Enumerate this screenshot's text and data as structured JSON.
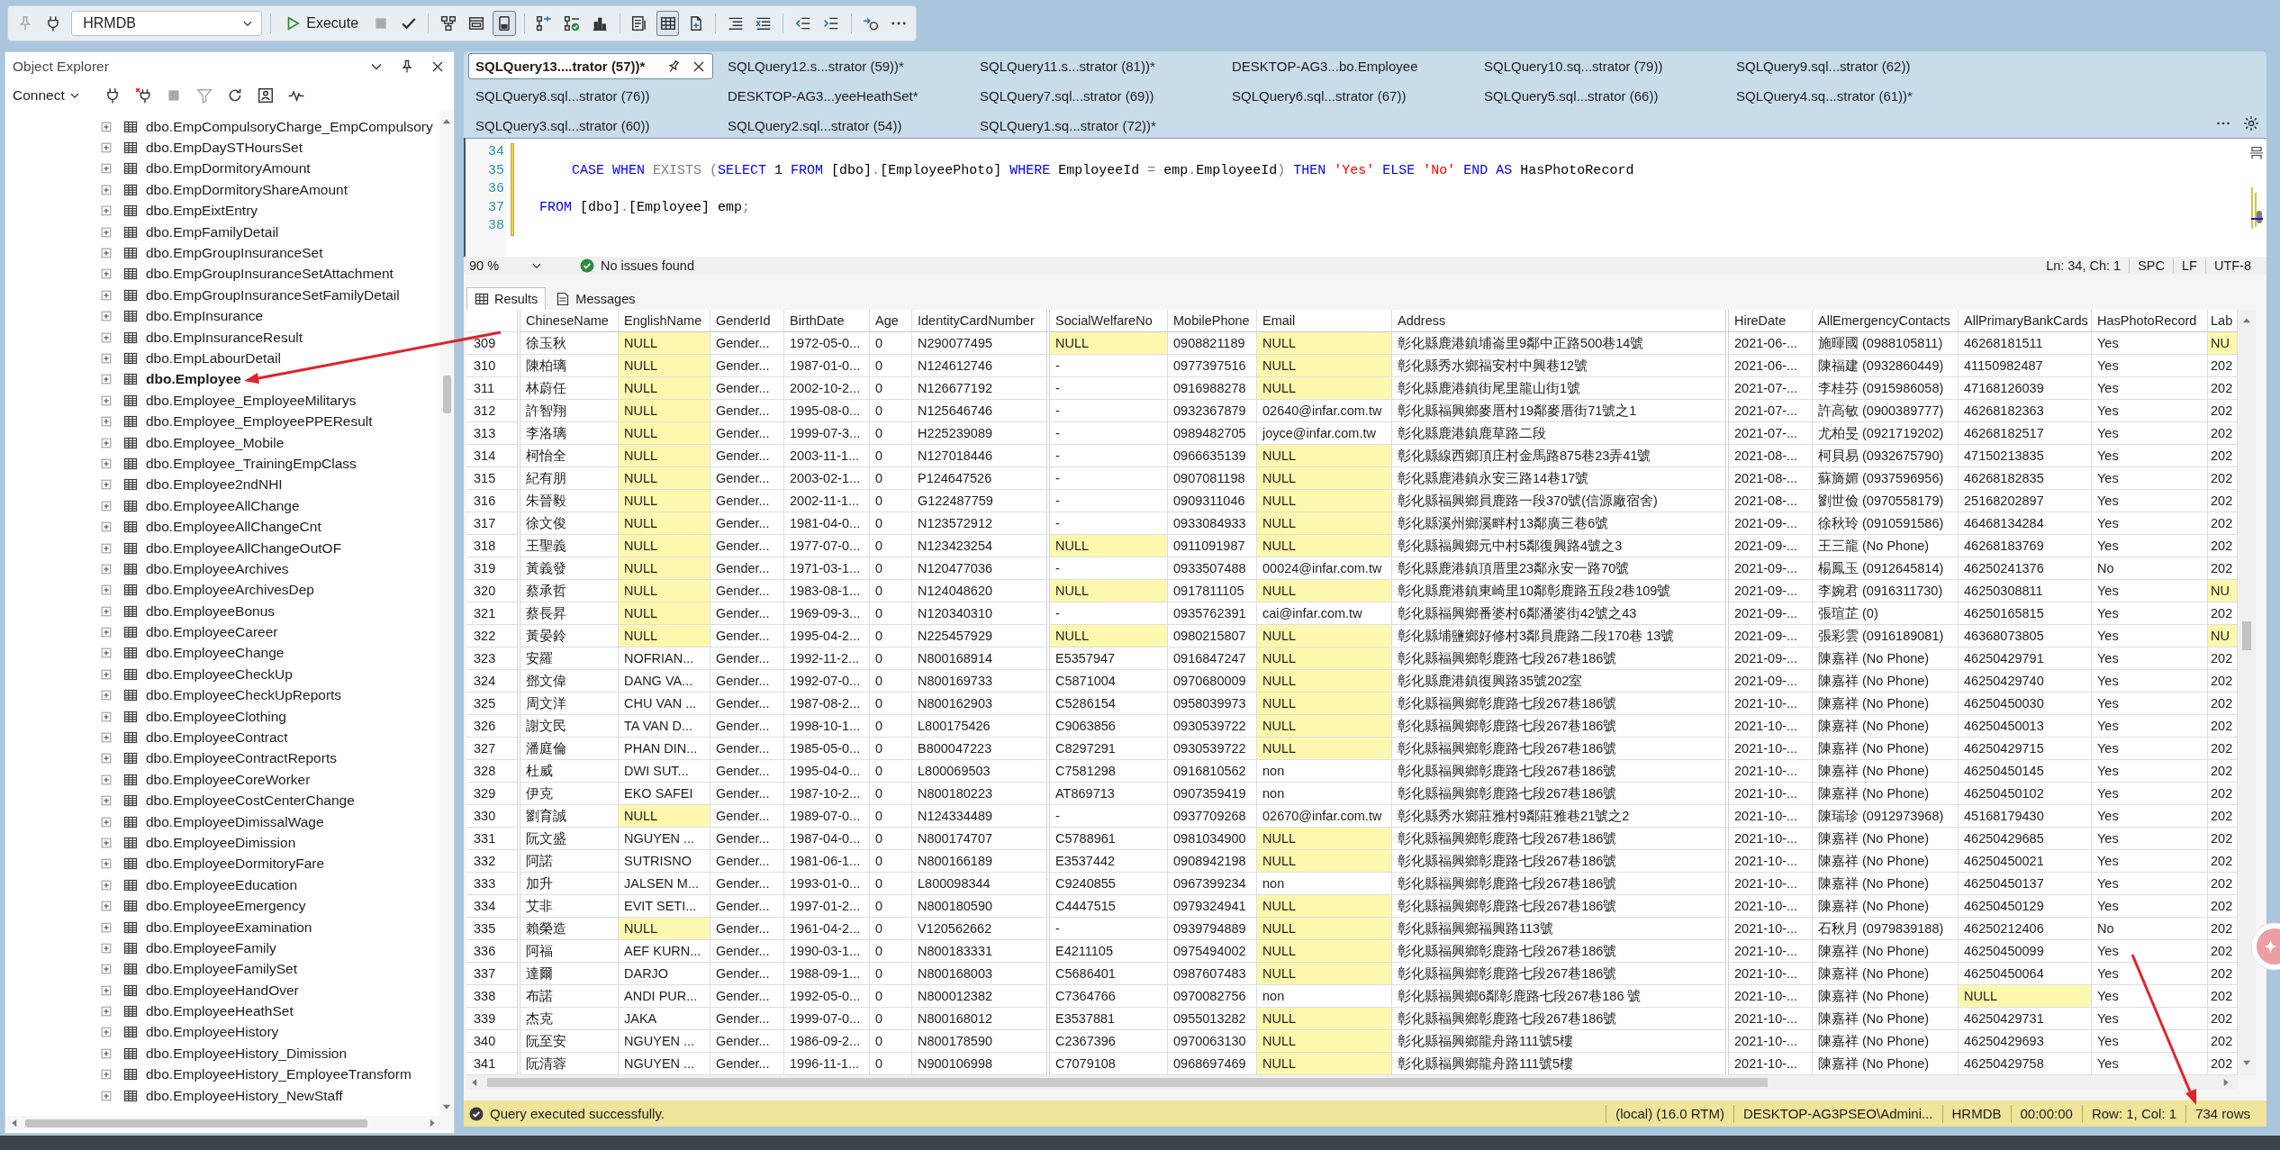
{
  "toolbar": {
    "leading_buttons": [
      {
        "disabled": true
      },
      {
        "disabled": false
      }
    ],
    "database": "HRMDB",
    "execute": "Execute",
    "buttons": [
      {
        "disabled": true,
        "on": false
      },
      {
        "disabled": false,
        "on": false
      },
      {
        "disabled": false,
        "on": false
      },
      {
        "disabled": false,
        "on": false
      },
      {
        "disabled": false,
        "on": true
      },
      {
        "disabled": false,
        "on": false
      },
      {
        "disabled": false,
        "on": false
      },
      {
        "disabled": false,
        "on": false
      },
      {
        "disabled": false,
        "on": false
      },
      {
        "disabled": false,
        "on": true
      },
      {
        "disabled": false,
        "on": false
      },
      {
        "disabled": false,
        "on": false
      },
      {
        "disabled": false,
        "on": false
      },
      {
        "disabled": false,
        "on": false
      },
      {
        "disabled": false,
        "on": false
      },
      {
        "disabled": false,
        "on": false
      },
      {
        "disabled": false,
        "on": false
      }
    ]
  },
  "object_explorer": {
    "title": "Object Explorer",
    "connect": "Connect",
    "toolbar_buttons": [
      {
        "disabled": false
      },
      {
        "disabled": false
      },
      {
        "disabled": true
      },
      {
        "disabled": true
      },
      {
        "disabled": false
      },
      {
        "disabled": false
      },
      {
        "disabled": false
      }
    ],
    "items": [
      {
        "label": "dbo.EmpCompulsoryCharge_EmpCompulsory",
        "expanded": false,
        "selected": false
      },
      {
        "label": "dbo.EmpDaySTHoursSet",
        "expanded": false,
        "selected": false
      },
      {
        "label": "dbo.EmpDormitoryAmount",
        "expanded": false,
        "selected": false
      },
      {
        "label": "dbo.EmpDormitoryShareAmount",
        "expanded": false,
        "selected": false
      },
      {
        "label": "dbo.EmpEixtEntry",
        "expanded": false,
        "selected": false
      },
      {
        "label": "dbo.EmpFamilyDetail",
        "expanded": false,
        "selected": false
      },
      {
        "label": "dbo.EmpGroupInsuranceSet",
        "expanded": false,
        "selected": false
      },
      {
        "label": "dbo.EmpGroupInsuranceSetAttachment",
        "expanded": false,
        "selected": false
      },
      {
        "label": "dbo.EmpGroupInsuranceSetFamilyDetail",
        "expanded": false,
        "selected": false
      },
      {
        "label": "dbo.EmpInsurance",
        "expanded": false,
        "selected": false
      },
      {
        "label": "dbo.EmpInsuranceResult",
        "expanded": false,
        "selected": false
      },
      {
        "label": "dbo.EmpLabourDetail",
        "expanded": false,
        "selected": false
      },
      {
        "label": "dbo.Employee",
        "expanded": false,
        "selected": true
      },
      {
        "label": "dbo.Employee_EmployeeMilitarys",
        "expanded": false,
        "selected": false
      },
      {
        "label": "dbo.Employee_EmployeePPEResult",
        "expanded": false,
        "selected": false
      },
      {
        "label": "dbo.Employee_Mobile",
        "expanded": false,
        "selected": false
      },
      {
        "label": "dbo.Employee_TrainingEmpClass",
        "expanded": false,
        "selected": false
      },
      {
        "label": "dbo.Employee2ndNHI",
        "expanded": false,
        "selected": false
      },
      {
        "label": "dbo.EmployeeAllChange",
        "expanded": false,
        "selected": false
      },
      {
        "label": "dbo.EmployeeAllChangeCnt",
        "expanded": false,
        "selected": false
      },
      {
        "label": "dbo.EmployeeAllChangeOutOF",
        "expanded": false,
        "selected": false
      },
      {
        "label": "dbo.EmployeeArchives",
        "expanded": false,
        "selected": false
      },
      {
        "label": "dbo.EmployeeArchivesDep",
        "expanded": false,
        "selected": false
      },
      {
        "label": "dbo.EmployeeBonus",
        "expanded": false,
        "selected": false
      },
      {
        "label": "dbo.EmployeeCareer",
        "expanded": false,
        "selected": false
      },
      {
        "label": "dbo.EmployeeChange",
        "expanded": false,
        "selected": false
      },
      {
        "label": "dbo.EmployeeCheckUp",
        "expanded": false,
        "selected": false
      },
      {
        "label": "dbo.EmployeeCheckUpReports",
        "expanded": false,
        "selected": false
      },
      {
        "label": "dbo.EmployeeClothing",
        "expanded": false,
        "selected": false
      },
      {
        "label": "dbo.EmployeeContract",
        "expanded": false,
        "selected": false
      },
      {
        "label": "dbo.EmployeeContractReports",
        "expanded": false,
        "selected": false
      },
      {
        "label": "dbo.EmployeeCoreWorker",
        "expanded": false,
        "selected": false
      },
      {
        "label": "dbo.EmployeeCostCenterChange",
        "expanded": false,
        "selected": false
      },
      {
        "label": "dbo.EmployeeDimissalWage",
        "expanded": false,
        "selected": false
      },
      {
        "label": "dbo.EmployeeDimission",
        "expanded": false,
        "selected": false
      },
      {
        "label": "dbo.EmployeeDormitoryFare",
        "expanded": false,
        "selected": false
      },
      {
        "label": "dbo.EmployeeEducation",
        "expanded": false,
        "selected": false
      },
      {
        "label": "dbo.EmployeeEmergency",
        "expanded": false,
        "selected": false
      },
      {
        "label": "dbo.EmployeeExamination",
        "expanded": false,
        "selected": false
      },
      {
        "label": "dbo.EmployeeFamily",
        "expanded": false,
        "selected": false
      },
      {
        "label": "dbo.EmployeeFamilySet",
        "expanded": false,
        "selected": false
      },
      {
        "label": "dbo.EmployeeHandOver",
        "expanded": false,
        "selected": false
      },
      {
        "label": "dbo.EmployeeHeathSet",
        "expanded": false,
        "selected": false
      },
      {
        "label": "dbo.EmployeeHistory",
        "expanded": false,
        "selected": false
      },
      {
        "label": "dbo.EmployeeHistory_Dimission",
        "expanded": false,
        "selected": false
      },
      {
        "label": "dbo.EmployeeHistory_EmployeeTransform",
        "expanded": false,
        "selected": false
      },
      {
        "label": "dbo.EmployeeHistory_NewStaff",
        "expanded": false,
        "selected": false
      }
    ]
  },
  "tabs": [
    {
      "label": "SQLQuery13....trator (57))*",
      "selected": true
    },
    {
      "label": "SQLQuery12.s...strator (59))*",
      "selected": false
    },
    {
      "label": "SQLQuery11.s...strator (81))*",
      "selected": false
    },
    {
      "label": "DESKTOP-AG3...bo.Employee",
      "selected": false
    },
    {
      "label": "SQLQuery10.sq...strator (79))",
      "selected": false
    },
    {
      "label": "SQLQuery9.sql...strator (62))",
      "selected": false
    },
    {
      "label": "SQLQuery8.sql...strator (76))",
      "selected": false
    },
    {
      "label": "DESKTOP-AG3...yeeHeathSet*",
      "selected": false
    },
    {
      "label": "SQLQuery7.sql...strator (69))",
      "selected": false
    },
    {
      "label": "SQLQuery6.sql...strator (67))",
      "selected": false
    },
    {
      "label": "SQLQuery5.sql...strator (66))",
      "selected": false
    },
    {
      "label": "SQLQuery4.sq...strator (61))*",
      "selected": false
    },
    {
      "label": "SQLQuery3.sql...strator (60))",
      "selected": false
    },
    {
      "label": "SQLQuery2.sql...strator (54))",
      "selected": false
    },
    {
      "label": "SQLQuery1.sq...strator (72))*",
      "selected": false
    }
  ],
  "editor": {
    "lines": [
      {
        "number": "34"
      },
      {
        "number": "35",
        "tokens": [
          {
            "text": "    CASE WHEN",
            "kind": "keyword"
          },
          {
            "text": " EXISTS (",
            "kind": "operator"
          },
          {
            "text": "SELECT",
            "kind": "keyword"
          },
          {
            "text": " 1 ",
            "kind": "plain"
          },
          {
            "text": "FROM",
            "kind": "keyword"
          },
          {
            "text": " [dbo]",
            "kind": "plain"
          },
          {
            "text": ".",
            "kind": "operator"
          },
          {
            "text": "[EmployeePhoto] ",
            "kind": "plain"
          },
          {
            "text": "WHERE",
            "kind": "keyword"
          },
          {
            "text": " EmployeeId ",
            "kind": "plain"
          },
          {
            "text": "=",
            "kind": "operator"
          },
          {
            "text": " emp",
            "kind": "plain"
          },
          {
            "text": ".",
            "kind": "operator"
          },
          {
            "text": "EmployeeId",
            "kind": "plain"
          },
          {
            "text": ")",
            "kind": "operator"
          },
          {
            "text": " THEN ",
            "kind": "keyword"
          },
          {
            "text": "'Yes'",
            "kind": "string"
          },
          {
            "text": " ELSE ",
            "kind": "keyword"
          },
          {
            "text": "'No'",
            "kind": "string"
          },
          {
            "text": " END AS",
            "kind": "keyword"
          },
          {
            "text": " HasPhotoRecord",
            "kind": "plain"
          }
        ]
      },
      {
        "number": "36"
      },
      {
        "number": "37",
        "tokens": [
          {
            "text": "FROM",
            "kind": "keyword"
          },
          {
            "text": " [dbo]",
            "kind": "plain"
          },
          {
            "text": ".",
            "kind": "operator"
          },
          {
            "text": "[Employee] emp",
            "kind": "plain"
          },
          {
            "text": ";",
            "kind": "operator"
          }
        ]
      },
      {
        "number": "38"
      }
    ]
  },
  "editor_status": {
    "zoom": "90 %",
    "issues": "No issues found",
    "position": "Ln: 34, Ch: 1",
    "indent": "SPC",
    "line_ending": "LF",
    "encoding": "UTF-8"
  },
  "result_tabs": [
    {
      "label": "Results",
      "selected": true
    },
    {
      "label": "Messages",
      "selected": false
    }
  ],
  "grid": {
    "columns": [
      "ChineseName",
      "EnglishName",
      "GenderId",
      "BirthDate",
      "Age",
      "IdentityCardNumber",
      "SocialWelfareNo",
      "MobilePhone",
      "Email",
      "Address",
      "HireDate",
      "AllEmergencyContacts",
      "AllPrimaryBankCards",
      "HasPhotoRecord",
      "Lab"
    ],
    "rows": [
      {
        "number": "309",
        "cells": [
          "徐玉秋",
          {
            "text": "NULL",
            "null": true
          },
          "Gender...",
          "1972-05-0...",
          "0",
          "N290077495",
          {
            "text": "NULL",
            "null": true
          },
          "0908821189",
          {
            "text": "NULL",
            "null": true
          },
          "彰化縣鹿港鎮埔崙里9鄰中正路500巷14號",
          "2021-06-...",
          "施暉國 (0988105811)",
          "46268181511",
          "Yes",
          {
            "text": "NU",
            "null": true
          }
        ]
      },
      {
        "number": "310",
        "cells": [
          "陳柏璃",
          {
            "text": "NULL",
            "null": true
          },
          "Gender...",
          "1987-01-0...",
          "0",
          "N124612746",
          "-",
          "0977397516",
          {
            "text": "NULL",
            "null": true
          },
          "彰化縣秀水鄉福安村中興巷12號",
          "2021-06-...",
          "陳福建 (0932860449)",
          "41150982487",
          "Yes",
          "202"
        ]
      },
      {
        "number": "311",
        "cells": [
          "林蔚任",
          {
            "text": "NULL",
            "null": true
          },
          "Gender...",
          "2002-10-2...",
          "0",
          "N126677192",
          "-",
          "0916988278",
          {
            "text": "NULL",
            "null": true
          },
          "彰化縣鹿港鎮街尾里龍山街1號",
          "2021-07-...",
          "李桂芬 (0915986058)",
          "47168126039",
          "Yes",
          "202"
        ]
      },
      {
        "number": "312",
        "cells": [
          "許智翔",
          {
            "text": "NULL",
            "null": true
          },
          "Gender...",
          "1995-08-0...",
          "0",
          "N125646746",
          "-",
          "0932367879",
          "02640@infar.com.tw",
          "彰化縣福興鄉麥厝村19鄰麥厝街71號之1",
          "2021-07-...",
          "許高敏 (0900389777)",
          "46268182363",
          "Yes",
          "202"
        ]
      },
      {
        "number": "313",
        "cells": [
          "李洛璃",
          {
            "text": "NULL",
            "null": true
          },
          "Gender...",
          "1999-07-3...",
          "0",
          "H225239089",
          "-",
          "0989482705",
          "joyce@infar.com.tw",
          "彰化縣鹿港鎮鹿草路二段",
          "2021-07-...",
          "尤柏旻 (0921719202)",
          "46268182517",
          "Yes",
          "202"
        ]
      },
      {
        "number": "314",
        "cells": [
          "柯怡全",
          {
            "text": "NULL",
            "null": true
          },
          "Gender...",
          "2003-11-1...",
          "0",
          "N127018446",
          "-",
          "0966635139",
          {
            "text": "NULL",
            "null": true
          },
          "彰化縣線西鄉頂庄村金馬路875巷23弄41號",
          "2021-08-...",
          "柯貝易 (0932675790)",
          "47150213835",
          "Yes",
          "202"
        ]
      },
      {
        "number": "315",
        "cells": [
          "紀有朋",
          {
            "text": "NULL",
            "null": true
          },
          "Gender...",
          "2003-02-1...",
          "0",
          "P124647526",
          "-",
          "0907081198",
          {
            "text": "NULL",
            "null": true
          },
          "彰化縣鹿港鎮永安三路14巷17號",
          "2021-08-...",
          "蘇旖媚 (0937596956)",
          "46268182835",
          "Yes",
          "202"
        ]
      },
      {
        "number": "316",
        "cells": [
          "朱晉毅",
          {
            "text": "NULL",
            "null": true
          },
          "Gender...",
          "2002-11-1...",
          "0",
          "G122487759",
          "-",
          "0909311046",
          {
            "text": "NULL",
            "null": true
          },
          "彰化縣福興鄉員鹿路一段370號(信源廠宿舍)",
          "2021-08-...",
          "劉世儉 (0970558179)",
          "25168202897",
          "Yes",
          "202"
        ]
      },
      {
        "number": "317",
        "cells": [
          "徐文俊",
          {
            "text": "NULL",
            "null": true
          },
          "Gender...",
          "1981-04-0...",
          "0",
          "N123572912",
          "-",
          "0933084933",
          {
            "text": "NULL",
            "null": true
          },
          "彰化縣溪州鄉溪畔村13鄰廣三巷6號",
          "2021-09-...",
          "徐秋玲 (0910591586)",
          "46468134284",
          "Yes",
          "202"
        ]
      },
      {
        "number": "318",
        "cells": [
          "王聖義",
          {
            "text": "NULL",
            "null": true
          },
          "Gender...",
          "1977-07-0...",
          "0",
          "N123423254",
          {
            "text": "NULL",
            "null": true
          },
          "0911091987",
          {
            "text": "NULL",
            "null": true
          },
          "彰化縣福興鄉元中村5鄰復興路4號之3",
          "2021-09-...",
          "王三龍 (No Phone)",
          "46268183769",
          "Yes",
          "202"
        ]
      },
      {
        "number": "319",
        "cells": [
          "黃義發",
          {
            "text": "NULL",
            "null": true
          },
          "Gender...",
          "1971-03-1...",
          "0",
          "N120477036",
          "-",
          "0933507488",
          "00024@infar.com.tw",
          "彰化縣鹿港鎮頂厝里23鄰永安一路70號",
          "2021-09-...",
          "楊鳳玉 (0912645814)",
          "46250241376",
          "No",
          "202"
        ]
      },
      {
        "number": "320",
        "cells": [
          "蔡承哲",
          {
            "text": "NULL",
            "null": true
          },
          "Gender...",
          "1983-08-1...",
          "0",
          "N124048620",
          {
            "text": "NULL",
            "null": true
          },
          "0917811105",
          {
            "text": "NULL",
            "null": true
          },
          "彰化縣鹿港鎮東崎里10鄰彰鹿路五段2巷109號",
          "2021-09-...",
          "李婉君 (0916311730)",
          "46250308811",
          "Yes",
          {
            "text": "NU",
            "null": true
          }
        ]
      },
      {
        "number": "321",
        "cells": [
          "蔡長昇",
          {
            "text": "NULL",
            "null": true
          },
          "Gender...",
          "1969-09-3...",
          "0",
          "N120340310",
          "-",
          "0935762391",
          "cai@infar.com.tw",
          "彰化縣福興鄉番婆村6鄰潘婆街42號之43",
          "2021-09-...",
          "張瑄芷 (0)",
          "46250165815",
          "Yes",
          "202"
        ]
      },
      {
        "number": "322",
        "cells": [
          "黃晏鈴",
          {
            "text": "NULL",
            "null": true
          },
          "Gender...",
          "1995-04-2...",
          "0",
          "N225457929",
          {
            "text": "NULL",
            "null": true
          },
          "0980215807",
          {
            "text": "NULL",
            "null": true
          },
          "彰化縣埔鹽鄉好修村3鄰員鹿路二段170巷 13號",
          "2021-09-...",
          "張彩雲 (0916189081)",
          "46368073805",
          "Yes",
          {
            "text": "NU",
            "null": true
          }
        ]
      },
      {
        "number": "323",
        "cells": [
          "安羅",
          "NOFRIAN...",
          "Gender...",
          "1992-11-2...",
          "0",
          "N800168914",
          "E5357947",
          "0916847247",
          {
            "text": "NULL",
            "null": true
          },
          "彰化縣福興鄉彰鹿路七段267巷186號",
          "2021-09-...",
          "陳嘉祥 (No Phone)",
          "46250429791",
          "Yes",
          "202"
        ]
      },
      {
        "number": "324",
        "cells": [
          "鄧文偉",
          "DANG VA...",
          "Gender...",
          "1992-07-0...",
          "0",
          "N800169733",
          "C5871004",
          "0970680009",
          {
            "text": "NULL",
            "null": true
          },
          "彰化縣鹿港鎮復興路35號202室",
          "2021-09-...",
          "陳嘉祥 (No Phone)",
          "46250429740",
          "Yes",
          "202"
        ]
      },
      {
        "number": "325",
        "cells": [
          "周文洋",
          "CHU VAN ...",
          "Gender...",
          "1987-08-2...",
          "0",
          "N800162903",
          "C5286154",
          "0958039973",
          {
            "text": "NULL",
            "null": true
          },
          "彰化縣福興鄉彰鹿路七段267巷186號",
          "2021-10-...",
          "陳嘉祥 (No Phone)",
          "46250450030",
          "Yes",
          "202"
        ]
      },
      {
        "number": "326",
        "cells": [
          "謝文民",
          "TA VAN D...",
          "Gender...",
          "1998-10-1...",
          "0",
          "L800175426",
          "C9063856",
          "0930539722",
          {
            "text": "NULL",
            "null": true
          },
          "彰化縣福興鄉彰鹿路七段267巷186號",
          "2021-10-...",
          "陳嘉祥 (No Phone)",
          "46250450013",
          "Yes",
          "202"
        ]
      },
      {
        "number": "327",
        "cells": [
          "潘庭倫",
          "PHAN DIN...",
          "Gender...",
          "1985-05-0...",
          "0",
          "B800047223",
          "C8297291",
          "0930539722",
          {
            "text": "NULL",
            "null": true
          },
          "彰化縣福興鄉彰鹿路七段267巷186號",
          "2021-10-...",
          "陳嘉祥 (No Phone)",
          "46250429715",
          "Yes",
          "202"
        ]
      },
      {
        "number": "328",
        "cells": [
          "杜威",
          "DWI SUT...",
          "Gender...",
          "1995-04-0...",
          "0",
          "L800069503",
          "C7581298",
          "0916810562",
          "non",
          "彰化縣福興鄉彰鹿路七段267巷186號",
          "2021-10-...",
          "陳嘉祥 (No Phone)",
          "46250450145",
          "Yes",
          "202"
        ]
      },
      {
        "number": "329",
        "cells": [
          "伊克",
          "EKO SAFEI",
          "Gender...",
          "1987-10-2...",
          "0",
          "N800180223",
          "AT869713",
          "0907359419",
          "non",
          "彰化縣福興鄉彰鹿路七段267巷186號",
          "2021-10-...",
          "陳嘉祥 (No Phone)",
          "46250450102",
          "Yes",
          "202"
        ]
      },
      {
        "number": "330",
        "cells": [
          "劉育誠",
          {
            "text": "NULL",
            "null": true
          },
          "Gender...",
          "1989-07-0...",
          "0",
          "N124334489",
          "-",
          "0937709268",
          "02670@infar.com.tw",
          "彰化縣秀水鄉莊雅村9鄰莊雅巷21號之2",
          "2021-10-...",
          "陳瑞珍 (0912973968)",
          "45168179430",
          "Yes",
          "202"
        ]
      },
      {
        "number": "331",
        "cells": [
          "阮文盛",
          "NGUYEN ...",
          "Gender...",
          "1987-04-0...",
          "0",
          "N800174707",
          "C5788961",
          "0981034900",
          {
            "text": "NULL",
            "null": true
          },
          "彰化縣福興鄉彰鹿路七段267巷186號",
          "2021-10-...",
          "陳嘉祥 (No Phone)",
          "46250429685",
          "Yes",
          "202"
        ]
      },
      {
        "number": "332",
        "cells": [
          "阿諾",
          "SUTRISNO",
          "Gender...",
          "1981-06-1...",
          "0",
          "N800166189",
          "E3537442",
          "0908942198",
          {
            "text": "NULL",
            "null": true
          },
          "彰化縣福興鄉彰鹿路七段267巷186號",
          "2021-10-...",
          "陳嘉祥 (No Phone)",
          "46250450021",
          "Yes",
          "202"
        ]
      },
      {
        "number": "333",
        "cells": [
          "加升",
          "JALSEN M...",
          "Gender...",
          "1993-01-0...",
          "0",
          "L800098344",
          "C9240855",
          "0967399234",
          "non",
          "彰化縣福興鄉彰鹿路七段267巷186號",
          "2021-10-...",
          "陳嘉祥 (No Phone)",
          "46250450137",
          "Yes",
          "202"
        ]
      },
      {
        "number": "334",
        "cells": [
          "艾非",
          "EVIT SETI...",
          "Gender...",
          "1997-01-2...",
          "0",
          "N800180590",
          "C4447515",
          "0979324941",
          {
            "text": "NULL",
            "null": true
          },
          "彰化縣福興鄉彰鹿路七段267巷186號",
          "2021-10-...",
          "陳嘉祥 (No Phone)",
          "46250450129",
          "Yes",
          "202"
        ]
      },
      {
        "number": "335",
        "cells": [
          "賴榮造",
          {
            "text": "NULL",
            "null": true
          },
          "Gender...",
          "1961-04-2...",
          "0",
          "V120562662",
          "-",
          "0939794889",
          {
            "text": "NULL",
            "null": true
          },
          "彰化縣福興鄉福興路113號",
          "2021-10-...",
          "石秋月 (0979839188)",
          "46250212406",
          "No",
          "202"
        ]
      },
      {
        "number": "336",
        "cells": [
          "阿福",
          "AEF KURN...",
          "Gender...",
          "1990-03-1...",
          "0",
          "N800183331",
          "E4211105",
          "0975494002",
          {
            "text": "NULL",
            "null": true
          },
          "彰化縣福興鄉彰鹿路七段267巷186號",
          "2021-10-...",
          "陳嘉祥 (No Phone)",
          "46250450099",
          "Yes",
          "202"
        ]
      },
      {
        "number": "337",
        "cells": [
          "達爾",
          "DARJO",
          "Gender...",
          "1988-09-1...",
          "0",
          "N800168003",
          "C5686401",
          "0987607483",
          {
            "text": "NULL",
            "null": true
          },
          "彰化縣福興鄉彰鹿路七段267巷186號",
          "2021-10-...",
          "陳嘉祥 (No Phone)",
          "46250450064",
          "Yes",
          "202"
        ]
      },
      {
        "number": "338",
        "cells": [
          "布諾",
          "ANDI PUR...",
          "Gender...",
          "1992-05-0...",
          "0",
          "N800012382",
          "C7364766",
          "0970082756",
          "non",
          "彰化縣福興鄉6鄰彰鹿路七段267巷186 號",
          "2021-10-...",
          "陳嘉祥 (No Phone)",
          {
            "text": "NULL",
            "null": true
          },
          "Yes",
          "202"
        ]
      },
      {
        "number": "339",
        "cells": [
          "杰克",
          "JAKA",
          "Gender...",
          "1999-07-0...",
          "0",
          "N800168012",
          "E3537881",
          "0955013282",
          {
            "text": "NULL",
            "null": true
          },
          "彰化縣福興鄉彰鹿路七段267巷186號",
          "2021-10-...",
          "陳嘉祥 (No Phone)",
          "46250429731",
          "Yes",
          "202"
        ]
      },
      {
        "number": "340",
        "cells": [
          "阮至安",
          "NGUYEN ...",
          "Gender...",
          "1986-09-2...",
          "0",
          "N800178590",
          "C2367396",
          "0970063130",
          {
            "text": "NULL",
            "null": true
          },
          "彰化縣福興鄉龍舟路111號5樓",
          "2021-10-...",
          "陳嘉祥 (No Phone)",
          "46250429693",
          "Yes",
          "202"
        ]
      },
      {
        "number": "341",
        "cells": [
          "阮清蓉",
          "NGUYEN ...",
          "Gender...",
          "1996-11-1...",
          "0",
          "N900106998",
          "C7079108",
          "0968697469",
          {
            "text": "NULL",
            "null": true
          },
          "彰化縣福興鄉龍舟路111號5樓",
          "2021-10-...",
          "陳嘉祥 (No Phone)",
          "46250429758",
          "Yes",
          "202"
        ]
      }
    ]
  },
  "status_bar": {
    "message": "Query executed successfully.",
    "server": "(local) (16.0 RTM)",
    "user": "DESKTOP-AG3PSEO\\Admini...",
    "database": "HRMDB",
    "elapsed": "00:00:00",
    "position": "Row: 1, Col: 1",
    "rows": "734 rows"
  }
}
